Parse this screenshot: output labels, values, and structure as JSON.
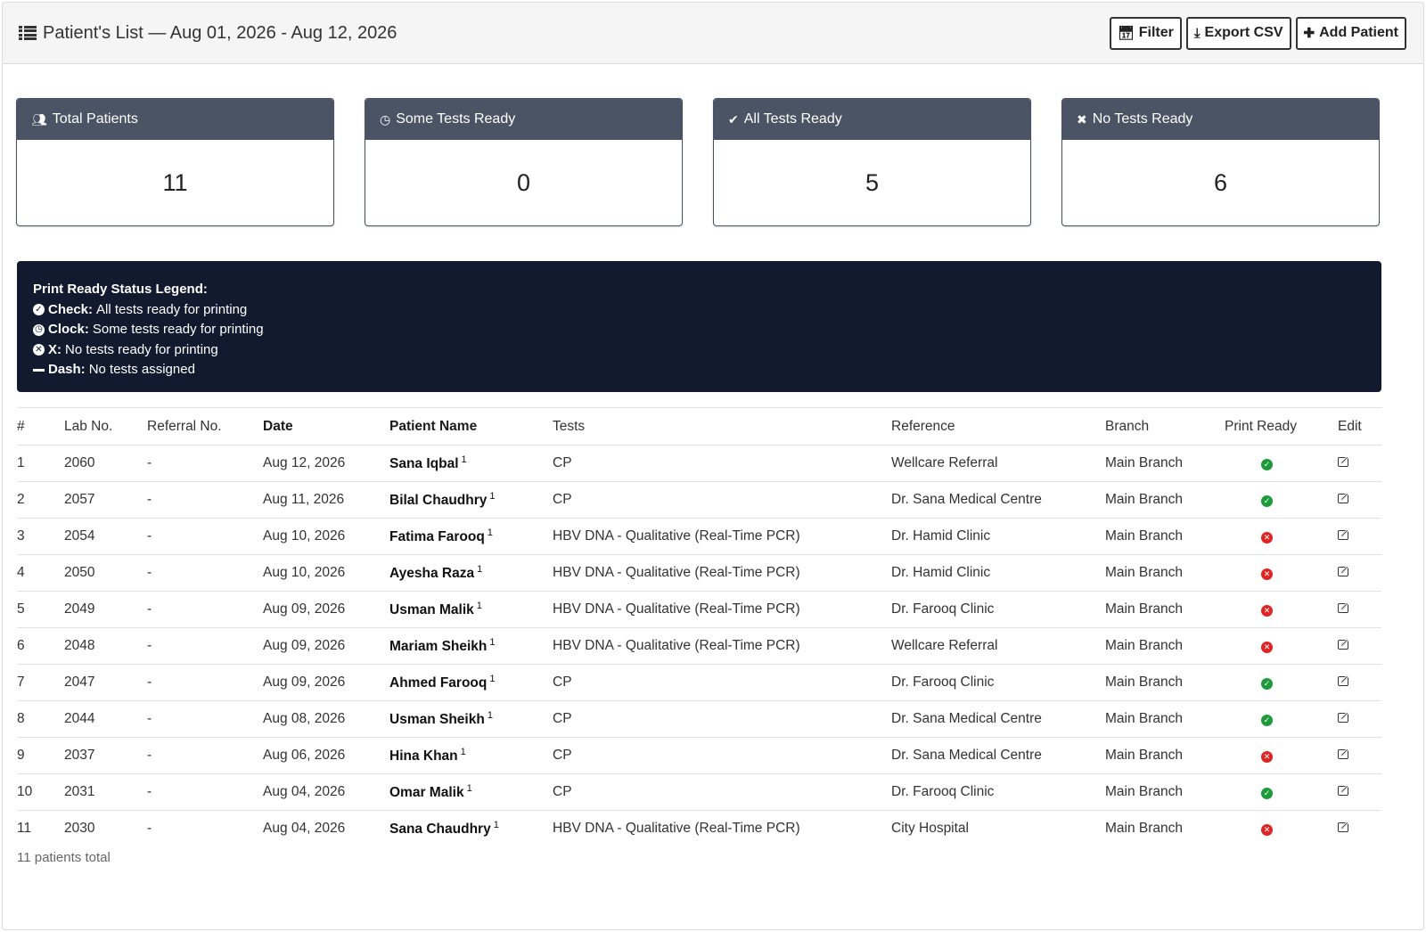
{
  "header": {
    "title": "Patient's List — Aug 01, 2026 - Aug 12, 2026",
    "buttons": {
      "filter": "Filter",
      "export": "Export CSV",
      "add": "Add Patient"
    }
  },
  "cards": [
    {
      "label": "Total Patients",
      "value": "11",
      "icon": "users-icon"
    },
    {
      "label": "Some Tests Ready",
      "value": "0",
      "icon": "clock-icon"
    },
    {
      "label": "All Tests Ready",
      "value": "5",
      "icon": "check-circle-icon"
    },
    {
      "label": "No Tests Ready",
      "value": "6",
      "icon": "x-circle-icon"
    }
  ],
  "legend": {
    "heading": "Print Ready Status Legend:",
    "items": [
      {
        "key": "Check:",
        "text": "All tests ready for printing"
      },
      {
        "key": "Clock:",
        "text": "Some tests ready for printing"
      },
      {
        "key": "X:",
        "text": "No tests ready for printing"
      },
      {
        "key": "Dash:",
        "text": "No tests assigned"
      }
    ]
  },
  "table": {
    "headers": [
      "#",
      "Lab No.",
      "Referral No.",
      "Date",
      "Patient Name",
      "Tests",
      "Reference",
      "Branch",
      "Print Ready",
      "Edit"
    ],
    "rows": [
      {
        "n": "1",
        "lab": "2060",
        "ref": "-",
        "date": "Aug 12, 2026",
        "name": "Sana Iqbal",
        "sup": "1",
        "tests": "CP",
        "reference": "Wellcare Referral",
        "branch": "Main Branch",
        "ready": "check"
      },
      {
        "n": "2",
        "lab": "2057",
        "ref": "-",
        "date": "Aug 11, 2026",
        "name": "Bilal Chaudhry",
        "sup": "1",
        "tests": "CP",
        "reference": "Dr. Sana Medical Centre",
        "branch": "Main Branch",
        "ready": "check"
      },
      {
        "n": "3",
        "lab": "2054",
        "ref": "-",
        "date": "Aug 10, 2026",
        "name": "Fatima Farooq",
        "sup": "1",
        "tests": "HBV DNA - Qualitative (Real-Time PCR)",
        "reference": "Dr. Hamid Clinic",
        "branch": "Main Branch",
        "ready": "x"
      },
      {
        "n": "4",
        "lab": "2050",
        "ref": "-",
        "date": "Aug 10, 2026",
        "name": "Ayesha Raza",
        "sup": "1",
        "tests": "HBV DNA - Qualitative (Real-Time PCR)",
        "reference": "Dr. Hamid Clinic",
        "branch": "Main Branch",
        "ready": "x"
      },
      {
        "n": "5",
        "lab": "2049",
        "ref": "-",
        "date": "Aug 09, 2026",
        "name": "Usman Malik",
        "sup": "1",
        "tests": "HBV DNA - Qualitative (Real-Time PCR)",
        "reference": "Dr. Farooq Clinic",
        "branch": "Main Branch",
        "ready": "x"
      },
      {
        "n": "6",
        "lab": "2048",
        "ref": "-",
        "date": "Aug 09, 2026",
        "name": "Mariam Sheikh",
        "sup": "1",
        "tests": "HBV DNA - Qualitative (Real-Time PCR)",
        "reference": "Wellcare Referral",
        "branch": "Main Branch",
        "ready": "x"
      },
      {
        "n": "7",
        "lab": "2047",
        "ref": "-",
        "date": "Aug 09, 2026",
        "name": "Ahmed Farooq",
        "sup": "1",
        "tests": "CP",
        "reference": "Dr. Farooq Clinic",
        "branch": "Main Branch",
        "ready": "check"
      },
      {
        "n": "8",
        "lab": "2044",
        "ref": "-",
        "date": "Aug 08, 2026",
        "name": "Usman Sheikh",
        "sup": "1",
        "tests": "CP",
        "reference": "Dr. Sana Medical Centre",
        "branch": "Main Branch",
        "ready": "check"
      },
      {
        "n": "9",
        "lab": "2037",
        "ref": "-",
        "date": "Aug 06, 2026",
        "name": "Hina Khan",
        "sup": "1",
        "tests": "CP",
        "reference": "Dr. Sana Medical Centre",
        "branch": "Main Branch",
        "ready": "x"
      },
      {
        "n": "10",
        "lab": "2031",
        "ref": "-",
        "date": "Aug 04, 2026",
        "name": "Omar Malik",
        "sup": "1",
        "tests": "CP",
        "reference": "Dr. Farooq Clinic",
        "branch": "Main Branch",
        "ready": "check"
      },
      {
        "n": "11",
        "lab": "2030",
        "ref": "-",
        "date": "Aug 04, 2026",
        "name": "Sana Chaudhry",
        "sup": "1",
        "tests": "HBV DNA - Qualitative (Real-Time PCR)",
        "reference": "City Hospital",
        "branch": "Main Branch",
        "ready": "x"
      }
    ]
  },
  "footer": {
    "total": "11 patients total"
  },
  "colors": {
    "ready_ok": "#1d9a3a",
    "ready_none": "#e02424",
    "legend_bg": "#111a2e",
    "card_head": "#4a5464"
  }
}
